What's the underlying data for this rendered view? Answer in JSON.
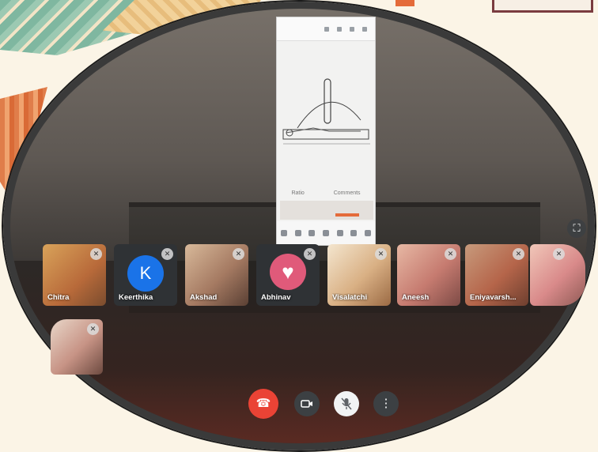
{
  "participants": [
    {
      "name": "Chitra",
      "avatar": "video"
    },
    {
      "name": "Keerthika",
      "avatar": "letter",
      "initial": "K",
      "color": "#1a73e8"
    },
    {
      "name": "Akshad",
      "avatar": "video"
    },
    {
      "name": "Abhinav",
      "avatar": "heart-image"
    },
    {
      "name": "Visalatchi",
      "avatar": "video"
    },
    {
      "name": "Aneesh",
      "avatar": "video"
    },
    {
      "name": "Eniyavarsh...",
      "avatar": "video"
    },
    {
      "name": "",
      "avatar": "video"
    },
    {
      "name": "",
      "avatar": "video"
    }
  ],
  "controls": {
    "end_call_icon": "phone-hangup-icon",
    "camera_icon": "video-camera-icon",
    "mic_icon": "mic-off-icon",
    "more_icon": "more-vert-icon",
    "fullscreen_icon": "fullscreen-icon"
  },
  "colors": {
    "end_call": "#ea4335",
    "control_dark": "#3c4043",
    "avatar_blue": "#1a73e8"
  },
  "shared_screen": {
    "label_left": "Ratio",
    "label_right": "Comments"
  }
}
